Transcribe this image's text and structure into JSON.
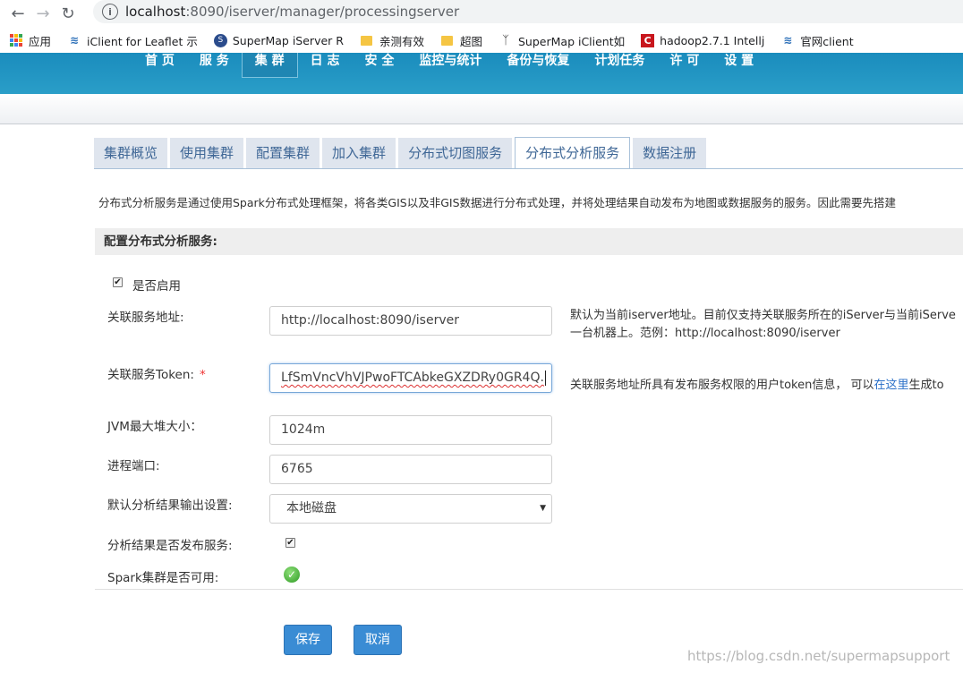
{
  "browser": {
    "url_host": "localhost",
    "url_path": ":8090/iserver/manager/processingserver",
    "bookmarks": [
      {
        "label": "应用",
        "icon": "apps-grid-icon"
      },
      {
        "label": "iClient for Leaflet 示",
        "icon": "supermap-wave-icon"
      },
      {
        "label": "SuperMap iServer R",
        "icon": "supermap-globe-icon"
      },
      {
        "label": "亲测有效",
        "icon": "folder-icon"
      },
      {
        "label": "超图",
        "icon": "folder-icon"
      },
      {
        "label": "SuperMap iClient如",
        "icon": "supermap-logo-icon"
      },
      {
        "label": "hadoop2.7.1 Intellj",
        "icon": "csdn-icon"
      },
      {
        "label": "官网client",
        "icon": "supermap-wave-icon"
      }
    ]
  },
  "menu": [
    "首 页",
    "服 务",
    "集 群",
    "日 志",
    "安 全",
    "监控与统计",
    "备份与恢复",
    "计划任务",
    "许 可",
    "设 置"
  ],
  "menu_active_index": 2,
  "tabs": [
    "集群概览",
    "使用集群",
    "配置集群",
    "加入集群",
    "分布式切图服务",
    "分布式分析服务",
    "数据注册"
  ],
  "tabs_active_index": 5,
  "description": "分布式分析服务是通过使用Spark分布式处理框架，将各类GIS以及非GIS数据进行分布式处理，并将处理结果自动发布为地图或数据服务的服务。因此需要先搭建",
  "section_title": "配置分布式分析服务:",
  "form": {
    "enable_label": "是否启用",
    "service_url_label": "关联服务地址:",
    "service_url_value": "http://localhost:8090/iserver",
    "service_url_hint_1": "默认为当前iserver地址。目前仅支持关联服务所在的iServer与当前iServe",
    "service_url_hint_2": "一台机器上。范例：http://localhost:8090/iserver",
    "token_label": "关联服务Token:",
    "token_required": "*",
    "token_value": "LfSmVncVhVJPwoFTCAbkeGXZDRy0GR4Q.",
    "token_hint_prefix": "关联服务地址所具有发布服务权限的用户token信息，  可以",
    "token_hint_link": "在这里",
    "token_hint_suffix": "生成to",
    "jvm_label": "JVM最大堆大小：",
    "jvm_value": "1024m",
    "port_label": "进程端口:",
    "port_value": "6765",
    "output_label": "默认分析结果输出设置:",
    "output_value": "本地磁盘",
    "publish_label": "分析结果是否发布服务:",
    "spark_label": "Spark集群是否可用:"
  },
  "buttons": {
    "save": "保存",
    "cancel": "取消"
  },
  "watermark": "https://blog.csdn.net/supermapsupport"
}
